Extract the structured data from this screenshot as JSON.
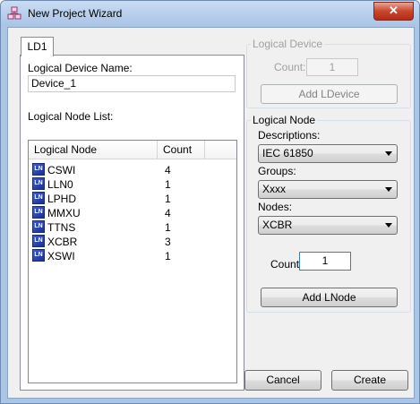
{
  "window": {
    "title": "New Project Wizard",
    "close_glyph": "✕"
  },
  "tab": {
    "label": "LD1"
  },
  "device_name": {
    "label": "Logical Device Name:",
    "value": "Device_1"
  },
  "node_list": {
    "label": "Logical Node List:",
    "columns": [
      "Logical Node",
      "Count"
    ],
    "icon_text": "LN",
    "rows": [
      {
        "name": "CSWI",
        "count": "4"
      },
      {
        "name": "LLN0",
        "count": "1"
      },
      {
        "name": "LPHD",
        "count": "1"
      },
      {
        "name": "MMXU",
        "count": "4"
      },
      {
        "name": "TTNS",
        "count": "1"
      },
      {
        "name": "XCBR",
        "count": "3"
      },
      {
        "name": "XSWI",
        "count": "1"
      }
    ]
  },
  "logical_device": {
    "legend": "Logical Device",
    "count_label": "Count:",
    "count_value": "1",
    "add_label": "Add LDevice"
  },
  "logical_node": {
    "legend": "Logical Node",
    "descriptions_label": "Descriptions:",
    "descriptions_value": "IEC 61850",
    "groups_label": "Groups:",
    "groups_value": "Xxxx",
    "nodes_label": "Nodes:",
    "nodes_value": "XCBR",
    "count_label": "Count:",
    "count_value": "1",
    "add_label": "Add LNode"
  },
  "footer": {
    "cancel_label": "Cancel",
    "create_label": "Create"
  },
  "colors": {
    "title_bar": "#a9c4e6",
    "close_button": "#c7472e",
    "count_focus_border": "#3c7fb1"
  }
}
